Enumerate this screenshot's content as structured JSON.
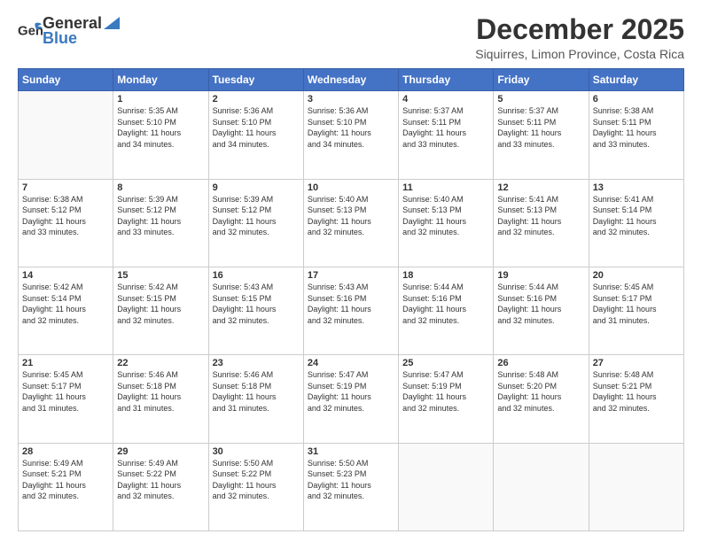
{
  "header": {
    "logo_general": "General",
    "logo_blue": "Blue",
    "month": "December 2025",
    "location": "Siquirres, Limon Province, Costa Rica"
  },
  "weekdays": [
    "Sunday",
    "Monday",
    "Tuesday",
    "Wednesday",
    "Thursday",
    "Friday",
    "Saturday"
  ],
  "weeks": [
    [
      {
        "day": "",
        "info": ""
      },
      {
        "day": "1",
        "info": "Sunrise: 5:35 AM\nSunset: 5:10 PM\nDaylight: 11 hours\nand 34 minutes."
      },
      {
        "day": "2",
        "info": "Sunrise: 5:36 AM\nSunset: 5:10 PM\nDaylight: 11 hours\nand 34 minutes."
      },
      {
        "day": "3",
        "info": "Sunrise: 5:36 AM\nSunset: 5:10 PM\nDaylight: 11 hours\nand 34 minutes."
      },
      {
        "day": "4",
        "info": "Sunrise: 5:37 AM\nSunset: 5:11 PM\nDaylight: 11 hours\nand 33 minutes."
      },
      {
        "day": "5",
        "info": "Sunrise: 5:37 AM\nSunset: 5:11 PM\nDaylight: 11 hours\nand 33 minutes."
      },
      {
        "day": "6",
        "info": "Sunrise: 5:38 AM\nSunset: 5:11 PM\nDaylight: 11 hours\nand 33 minutes."
      }
    ],
    [
      {
        "day": "7",
        "info": "Sunrise: 5:38 AM\nSunset: 5:12 PM\nDaylight: 11 hours\nand 33 minutes."
      },
      {
        "day": "8",
        "info": "Sunrise: 5:39 AM\nSunset: 5:12 PM\nDaylight: 11 hours\nand 33 minutes."
      },
      {
        "day": "9",
        "info": "Sunrise: 5:39 AM\nSunset: 5:12 PM\nDaylight: 11 hours\nand 32 minutes."
      },
      {
        "day": "10",
        "info": "Sunrise: 5:40 AM\nSunset: 5:13 PM\nDaylight: 11 hours\nand 32 minutes."
      },
      {
        "day": "11",
        "info": "Sunrise: 5:40 AM\nSunset: 5:13 PM\nDaylight: 11 hours\nand 32 minutes."
      },
      {
        "day": "12",
        "info": "Sunrise: 5:41 AM\nSunset: 5:13 PM\nDaylight: 11 hours\nand 32 minutes."
      },
      {
        "day": "13",
        "info": "Sunrise: 5:41 AM\nSunset: 5:14 PM\nDaylight: 11 hours\nand 32 minutes."
      }
    ],
    [
      {
        "day": "14",
        "info": "Sunrise: 5:42 AM\nSunset: 5:14 PM\nDaylight: 11 hours\nand 32 minutes."
      },
      {
        "day": "15",
        "info": "Sunrise: 5:42 AM\nSunset: 5:15 PM\nDaylight: 11 hours\nand 32 minutes."
      },
      {
        "day": "16",
        "info": "Sunrise: 5:43 AM\nSunset: 5:15 PM\nDaylight: 11 hours\nand 32 minutes."
      },
      {
        "day": "17",
        "info": "Sunrise: 5:43 AM\nSunset: 5:16 PM\nDaylight: 11 hours\nand 32 minutes."
      },
      {
        "day": "18",
        "info": "Sunrise: 5:44 AM\nSunset: 5:16 PM\nDaylight: 11 hours\nand 32 minutes."
      },
      {
        "day": "19",
        "info": "Sunrise: 5:44 AM\nSunset: 5:16 PM\nDaylight: 11 hours\nand 32 minutes."
      },
      {
        "day": "20",
        "info": "Sunrise: 5:45 AM\nSunset: 5:17 PM\nDaylight: 11 hours\nand 31 minutes."
      }
    ],
    [
      {
        "day": "21",
        "info": "Sunrise: 5:45 AM\nSunset: 5:17 PM\nDaylight: 11 hours\nand 31 minutes."
      },
      {
        "day": "22",
        "info": "Sunrise: 5:46 AM\nSunset: 5:18 PM\nDaylight: 11 hours\nand 31 minutes."
      },
      {
        "day": "23",
        "info": "Sunrise: 5:46 AM\nSunset: 5:18 PM\nDaylight: 11 hours\nand 31 minutes."
      },
      {
        "day": "24",
        "info": "Sunrise: 5:47 AM\nSunset: 5:19 PM\nDaylight: 11 hours\nand 32 minutes."
      },
      {
        "day": "25",
        "info": "Sunrise: 5:47 AM\nSunset: 5:19 PM\nDaylight: 11 hours\nand 32 minutes."
      },
      {
        "day": "26",
        "info": "Sunrise: 5:48 AM\nSunset: 5:20 PM\nDaylight: 11 hours\nand 32 minutes."
      },
      {
        "day": "27",
        "info": "Sunrise: 5:48 AM\nSunset: 5:21 PM\nDaylight: 11 hours\nand 32 minutes."
      }
    ],
    [
      {
        "day": "28",
        "info": "Sunrise: 5:49 AM\nSunset: 5:21 PM\nDaylight: 11 hours\nand 32 minutes."
      },
      {
        "day": "29",
        "info": "Sunrise: 5:49 AM\nSunset: 5:22 PM\nDaylight: 11 hours\nand 32 minutes."
      },
      {
        "day": "30",
        "info": "Sunrise: 5:50 AM\nSunset: 5:22 PM\nDaylight: 11 hours\nand 32 minutes."
      },
      {
        "day": "31",
        "info": "Sunrise: 5:50 AM\nSunset: 5:23 PM\nDaylight: 11 hours\nand 32 minutes."
      },
      {
        "day": "",
        "info": ""
      },
      {
        "day": "",
        "info": ""
      },
      {
        "day": "",
        "info": ""
      }
    ]
  ]
}
